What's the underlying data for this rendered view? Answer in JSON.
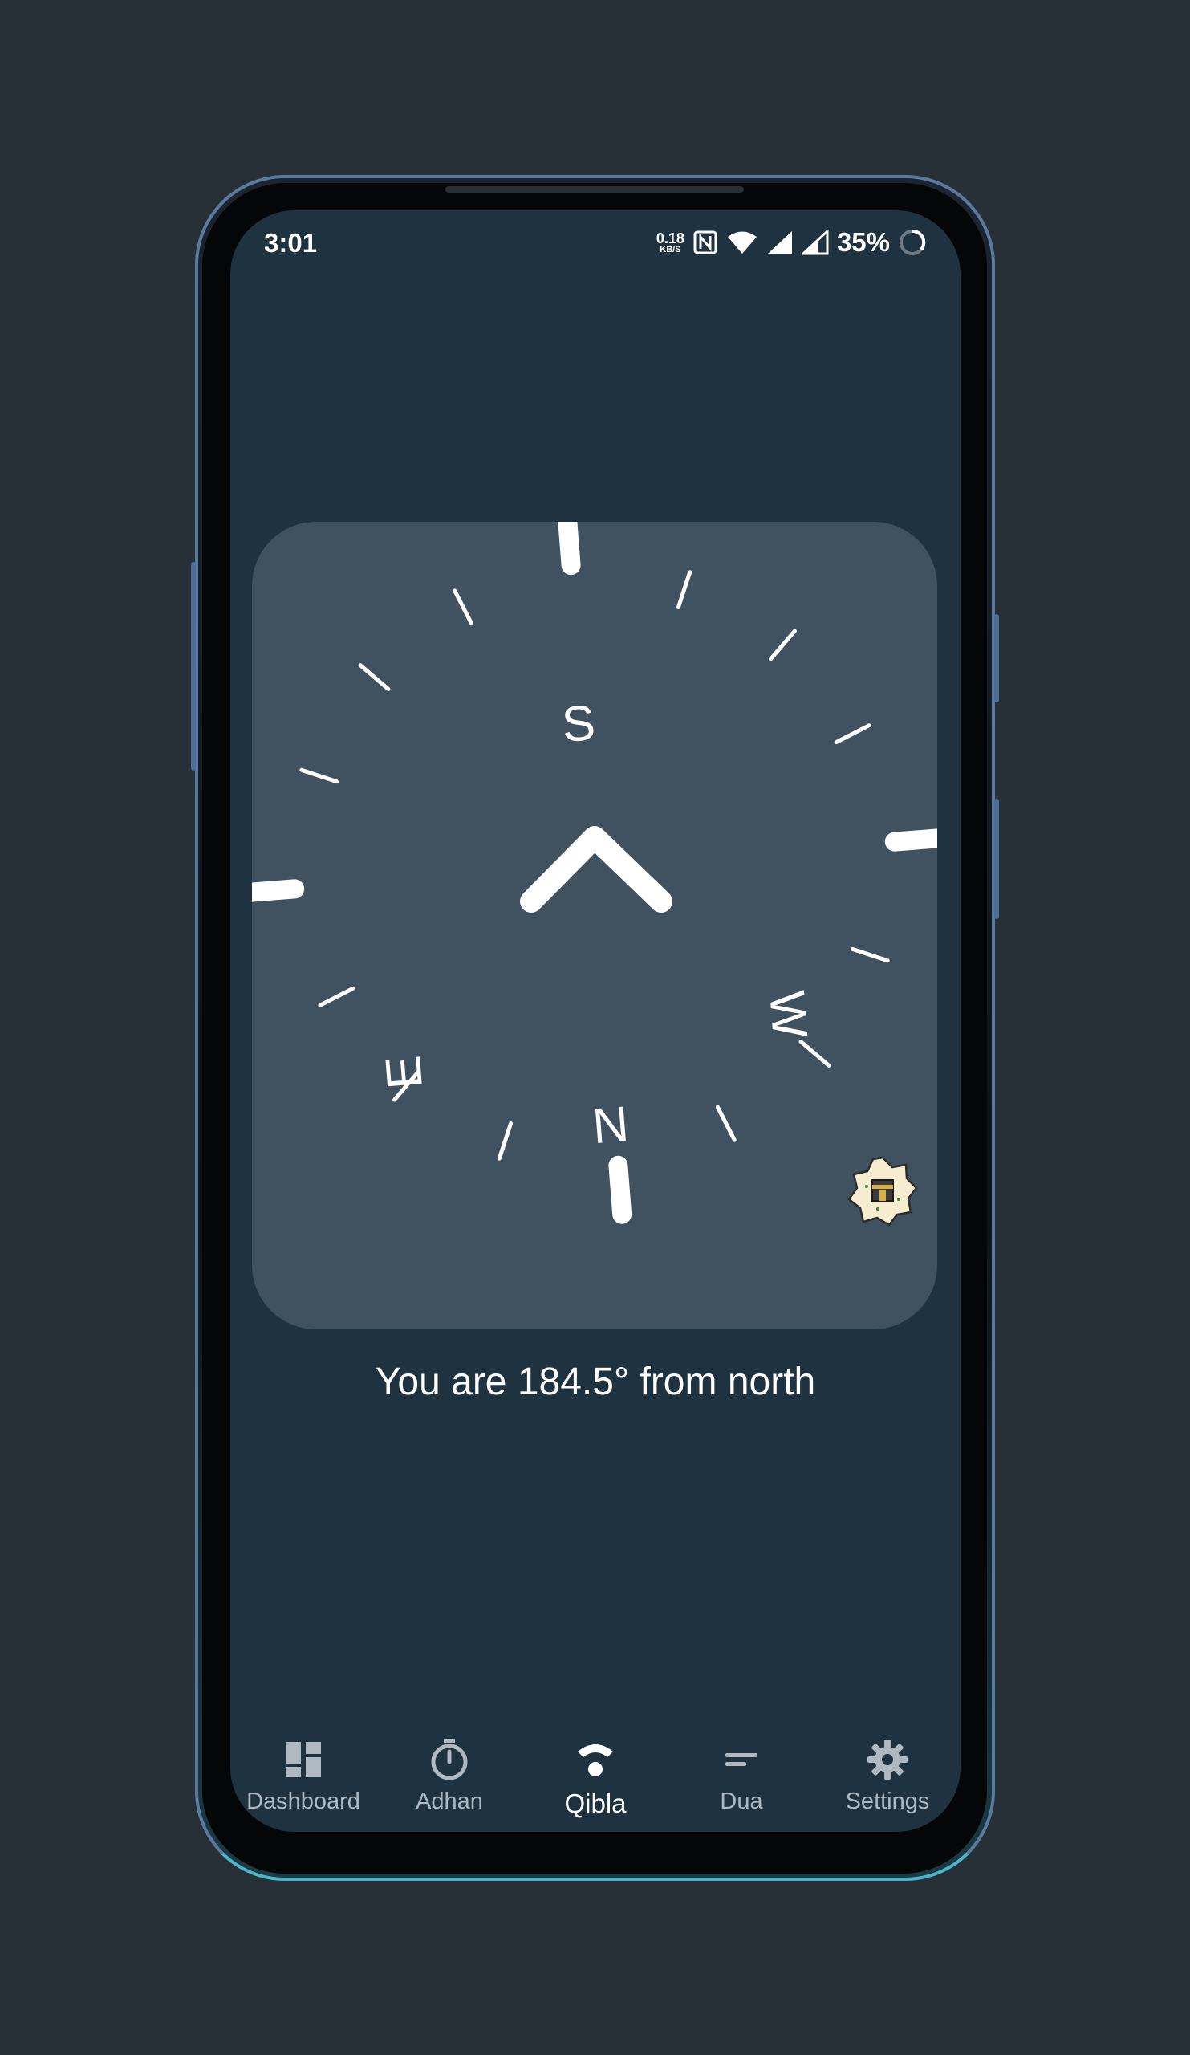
{
  "status_bar": {
    "time": "3:01",
    "net_speed_value": "0.18",
    "net_speed_unit": "KB/S",
    "battery_percent": "35%",
    "icons": [
      "nfc-icon",
      "wifi-icon",
      "signal-icon",
      "signal-icon",
      "battery-ring-icon"
    ]
  },
  "compass": {
    "cardinals": {
      "north": "N",
      "south": "S",
      "east": "E",
      "west": "W"
    },
    "qibla_icon": "kaaba-icon",
    "pointer_icon": "chevron-up-icon"
  },
  "heading": {
    "text": "You are 184.5° from north"
  },
  "bottom_nav": {
    "items": [
      {
        "label": "Dashboard",
        "icon": "dashboard-icon",
        "active": false
      },
      {
        "label": "Adhan",
        "icon": "timer-icon",
        "active": false
      },
      {
        "label": "Qibla",
        "icon": "qibla-icon",
        "active": true
      },
      {
        "label": "Dua",
        "icon": "dua-icon",
        "active": false
      },
      {
        "label": "Settings",
        "icon": "gear-icon",
        "active": false
      }
    ]
  },
  "colors": {
    "background": "#263036",
    "screen": "#1f323f",
    "card": "#40525f",
    "accent": "#ffffff",
    "nav_inactive": "#aeb9c1"
  }
}
